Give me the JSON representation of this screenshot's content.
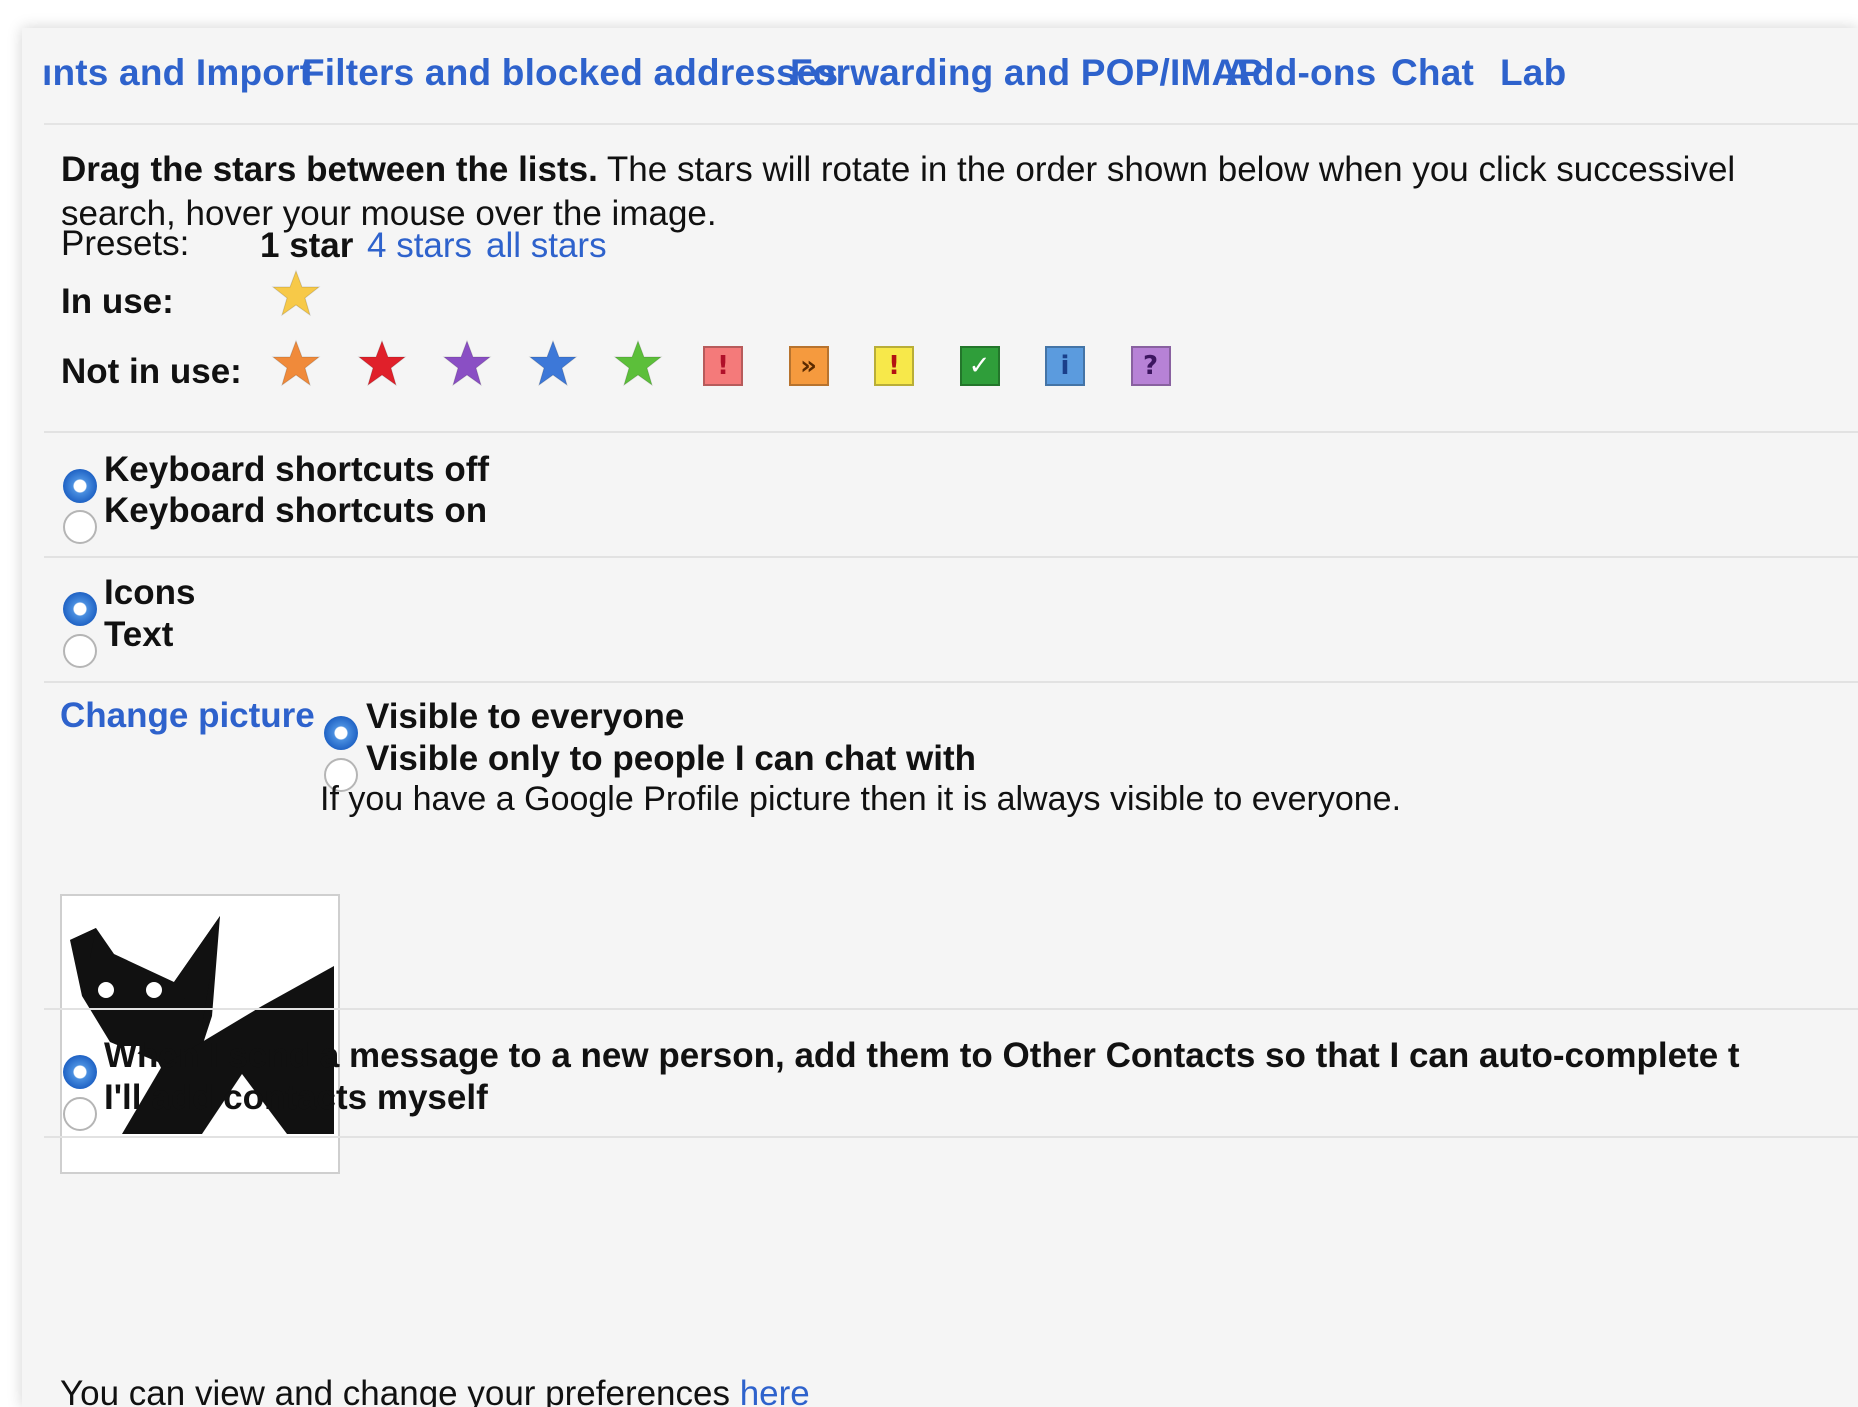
{
  "tabs": [
    {
      "label": "ınts and Import"
    },
    {
      "label": "Filters and blocked addresses"
    },
    {
      "label": "Forwarding and POP/IMAP"
    },
    {
      "label": "Add-ons"
    },
    {
      "label": "Chat"
    },
    {
      "label": "Lab"
    }
  ],
  "stars": {
    "intro_bold": "Drag the stars between the lists.",
    "intro_line1": "The stars will rotate in the order shown below when you click successivel",
    "intro_line2": "search, hover your mouse over the image.",
    "presets_label": "Presets:",
    "preset_current": "1 star",
    "preset_links": [
      "4 stars",
      "all stars"
    ],
    "in_use_label": "In use:",
    "not_in_use_label": "Not in use:",
    "in_use_icons": [
      "yellow-star"
    ],
    "not_in_use_icons": [
      "orange-star",
      "red-star",
      "purple-star",
      "blue-star",
      "green-star",
      "red-bang",
      "orange-guillemet",
      "yellow-bang",
      "green-check",
      "blue-info",
      "purple-question"
    ],
    "box_glyphs": [
      "!",
      "»",
      "!",
      "✓",
      "i",
      "?"
    ],
    "colors": {
      "yellow": "#f7c948",
      "orange": "#f08a3a",
      "red": "#e0202a",
      "purple": "#8a4fc4",
      "blue": "#3d78d8",
      "green": "#5cbf3a",
      "box_red": "#f47a7a",
      "box_orange": "#f59a3e",
      "box_yellow": "#f7e84a",
      "box_green": "#2f9e3a",
      "box_blue": "#5b9bde",
      "box_purple": "#b782d6"
    }
  },
  "keyboard": {
    "off": "Keyboard shortcuts off",
    "on": "Keyboard shortcuts on",
    "selected": "off"
  },
  "button_labels": {
    "icons": "Icons",
    "text": "Text",
    "selected": "icons"
  },
  "picture": {
    "change_link": "Change picture",
    "visible_everyone": "Visible to everyone",
    "visible_chat": "Visible only to people I can chat with",
    "note": "If you have a Google Profile picture then it is always visible to everyone.",
    "selected": "everyone"
  },
  "contacts": {
    "auto": "When I send a message to a new person, add them to Other Contacts so that I can auto-complete t",
    "manual": "I'll add contacts myself",
    "selected": "auto"
  },
  "footer": {
    "text": "You can view and change your preferences ",
    "link": "here"
  }
}
